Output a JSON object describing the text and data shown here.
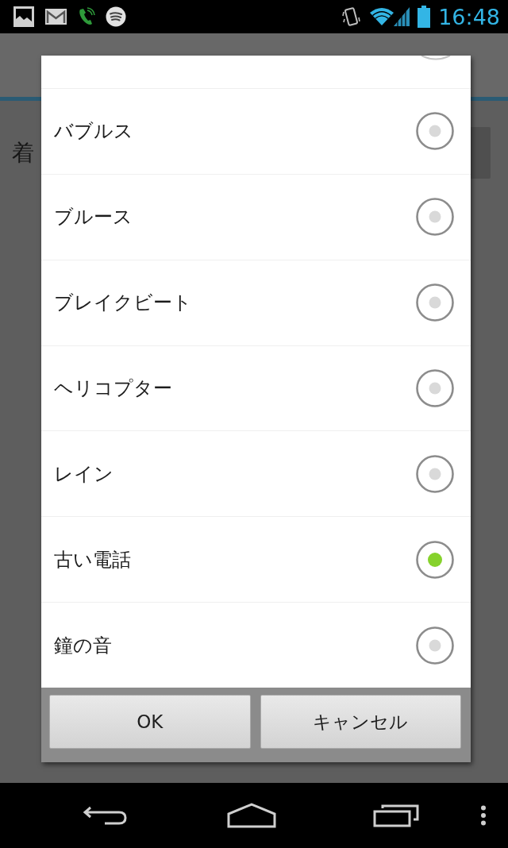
{
  "status_bar": {
    "time": "16:48"
  },
  "background": {
    "label": "着"
  },
  "dialog": {
    "options": [
      {
        "label": "バブルス",
        "selected": false
      },
      {
        "label": "ブルース",
        "selected": false
      },
      {
        "label": "ブレイクビート",
        "selected": false
      },
      {
        "label": "ヘリコプター",
        "selected": false
      },
      {
        "label": "レイン",
        "selected": false
      },
      {
        "label": "古い電話",
        "selected": true
      },
      {
        "label": "鐘の音",
        "selected": false
      }
    ],
    "buttons": [
      "OK",
      "キャンセル"
    ]
  }
}
